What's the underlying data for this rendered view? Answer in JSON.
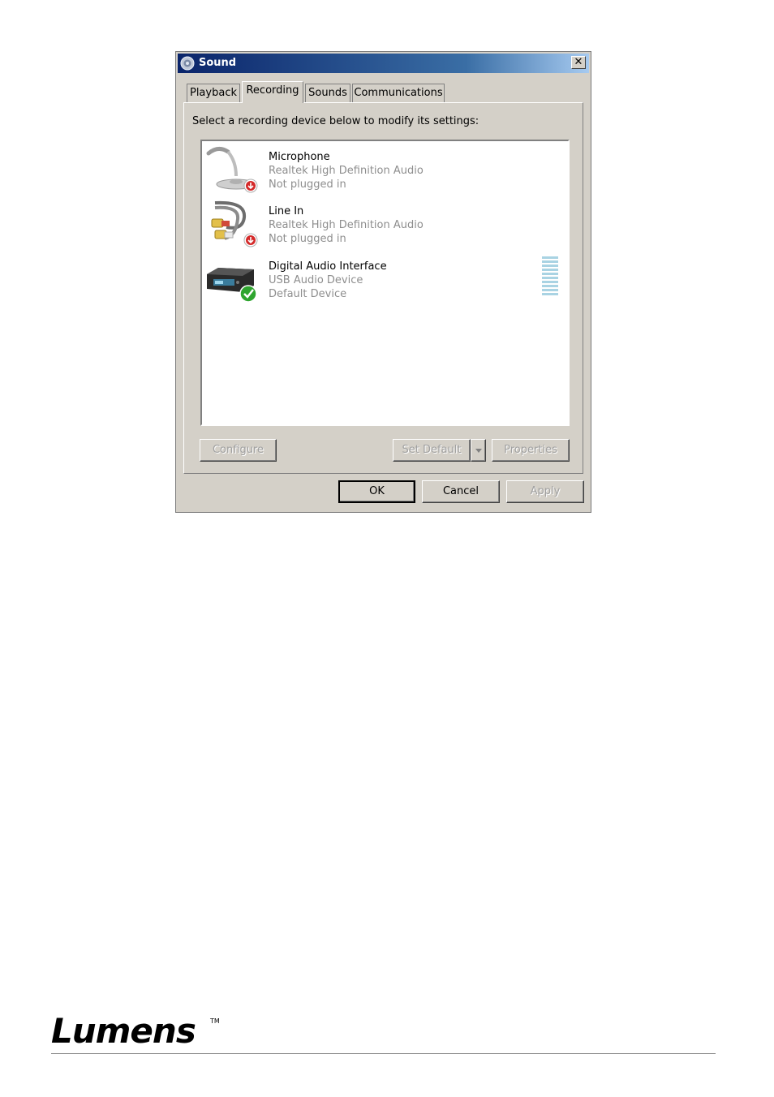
{
  "window": {
    "title": "Sound",
    "close_label": "✕"
  },
  "tabs": [
    {
      "label": "Playback",
      "active": false
    },
    {
      "label": "Recording",
      "active": true
    },
    {
      "label": "Sounds",
      "active": false
    },
    {
      "label": "Communications",
      "active": false
    }
  ],
  "instruction": "Select a recording device below to modify its settings:",
  "devices": [
    {
      "name": "Microphone",
      "driver": "Realtek High Definition Audio",
      "status": "Not plugged in",
      "icon": "microphone-icon",
      "badge": "unplugged-badge-icon"
    },
    {
      "name": "Line In",
      "driver": "Realtek High Definition Audio",
      "status": "Not plugged in",
      "icon": "line-in-cable-icon",
      "badge": "unplugged-badge-icon"
    },
    {
      "name": "Digital Audio Interface",
      "driver": "USB Audio Device",
      "status": "Default Device",
      "icon": "usb-audio-device-icon",
      "badge": "default-checkmark-icon"
    }
  ],
  "buttons": {
    "configure": "Configure",
    "set_default": "Set Default",
    "properties": "Properties",
    "ok": "OK",
    "cancel": "Cancel",
    "apply": "Apply"
  },
  "colors": {
    "titlebar_start": "#0a246a",
    "titlebar_end": "#a6caf0",
    "secondary_text": "#8e8e8e",
    "level_meter": "#a9d3e3"
  },
  "footer": {
    "brand": "Lumens",
    "trademark": "TM"
  }
}
